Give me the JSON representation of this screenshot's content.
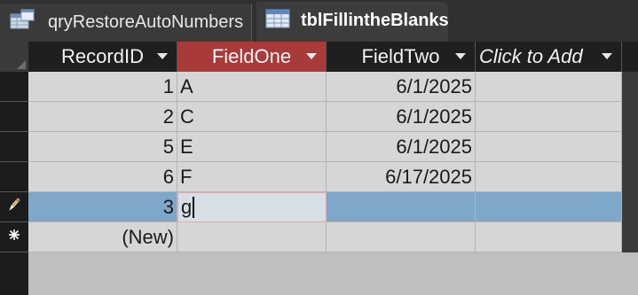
{
  "tabs": [
    {
      "label": "qryRestoreAutoNumbers",
      "icon": "query-icon"
    },
    {
      "label": "tblFillintheBlanks",
      "icon": "table-icon",
      "active": true
    }
  ],
  "columns": [
    {
      "label": "RecordID"
    },
    {
      "label": "FieldOne",
      "active": true
    },
    {
      "label": "FieldTwo"
    },
    {
      "label": "Click to Add",
      "italic": true
    }
  ],
  "rows": [
    {
      "selector": "",
      "record_id": "1",
      "field_one": "A",
      "field_two": "6/1/2025",
      "add": ""
    },
    {
      "selector": "",
      "record_id": "2",
      "field_one": "C",
      "field_two": "6/1/2025",
      "add": ""
    },
    {
      "selector": "",
      "record_id": "5",
      "field_one": "E",
      "field_two": "6/1/2025",
      "add": ""
    },
    {
      "selector": "",
      "record_id": "6",
      "field_one": "F",
      "field_two": "6/17/2025",
      "add": ""
    },
    {
      "selector": "pencil-icon",
      "record_id": "3",
      "field_one": "g",
      "field_two": "",
      "add": "",
      "current": true
    },
    {
      "selector": "new-record-icon",
      "record_id": "(New)",
      "field_one": "",
      "field_two": "",
      "add": ""
    }
  ],
  "colors": {
    "active_header": "#a83a3a",
    "current_row": "#7ea7c9",
    "cell_bg": "#d6d6d6"
  }
}
